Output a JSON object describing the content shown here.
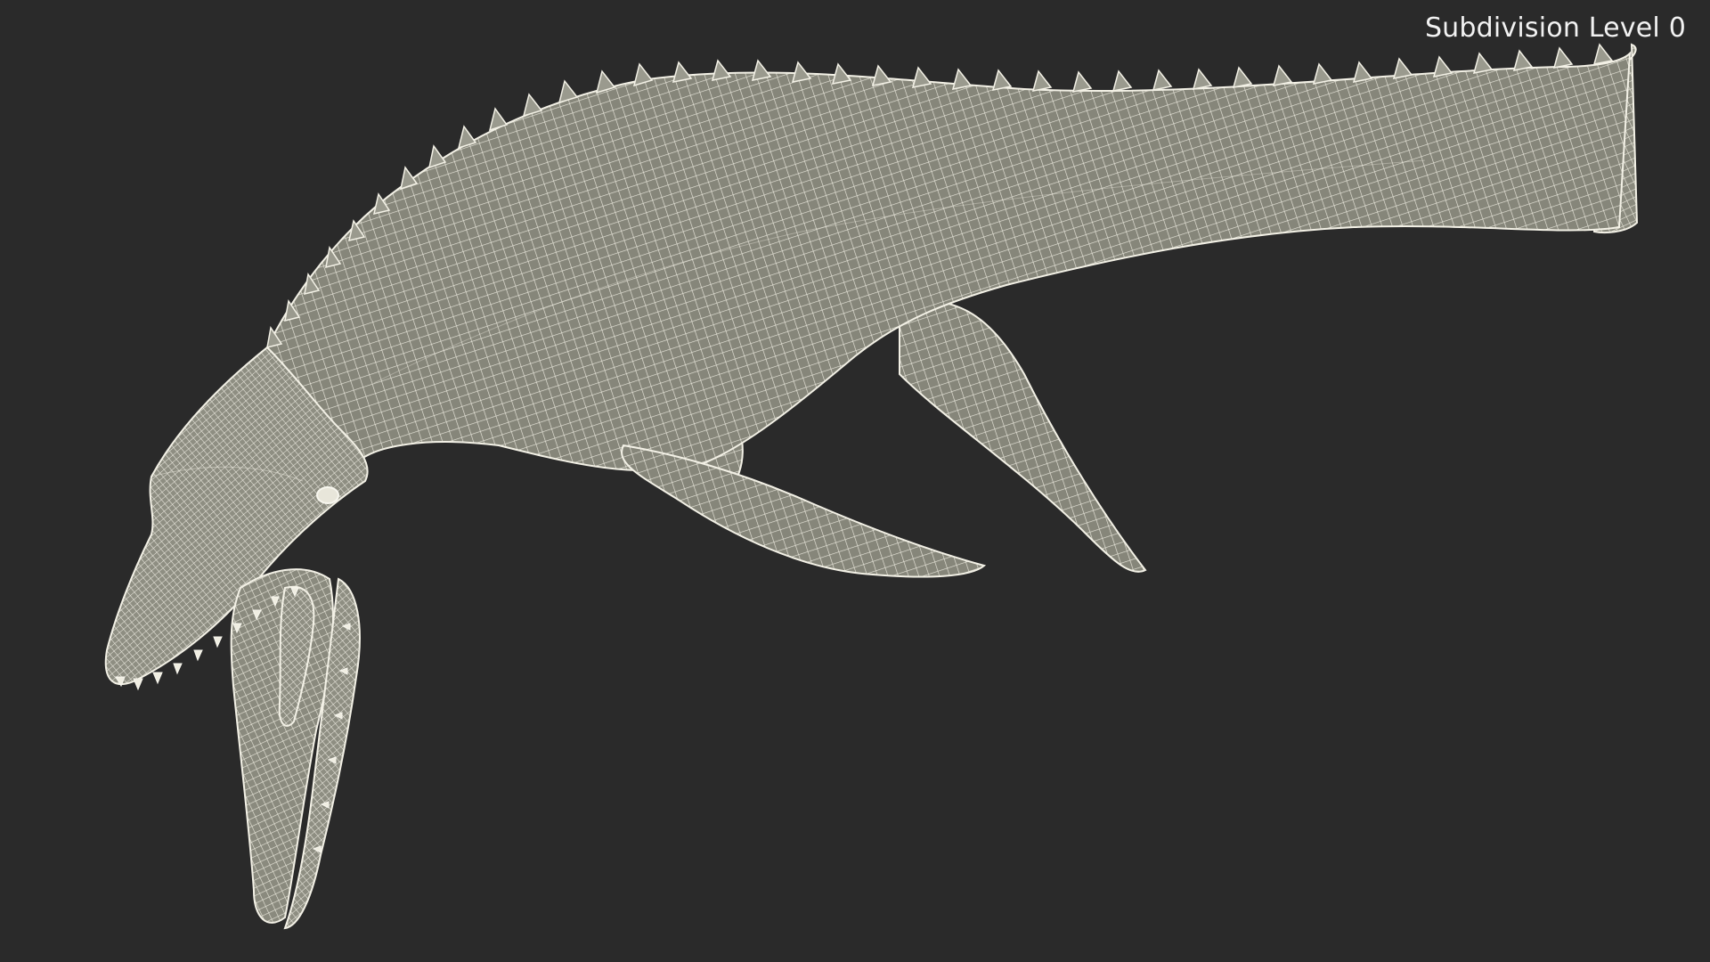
{
  "viewport": {
    "background_color": "#2a2a2a",
    "overlay_label": "Subdivision Level 0"
  },
  "model": {
    "render_style": "wireframe",
    "mesh_fill_color": "#86867a",
    "wire_color": "#f3f1e6",
    "subject_icon": "mosasaur-wireframe-model"
  }
}
